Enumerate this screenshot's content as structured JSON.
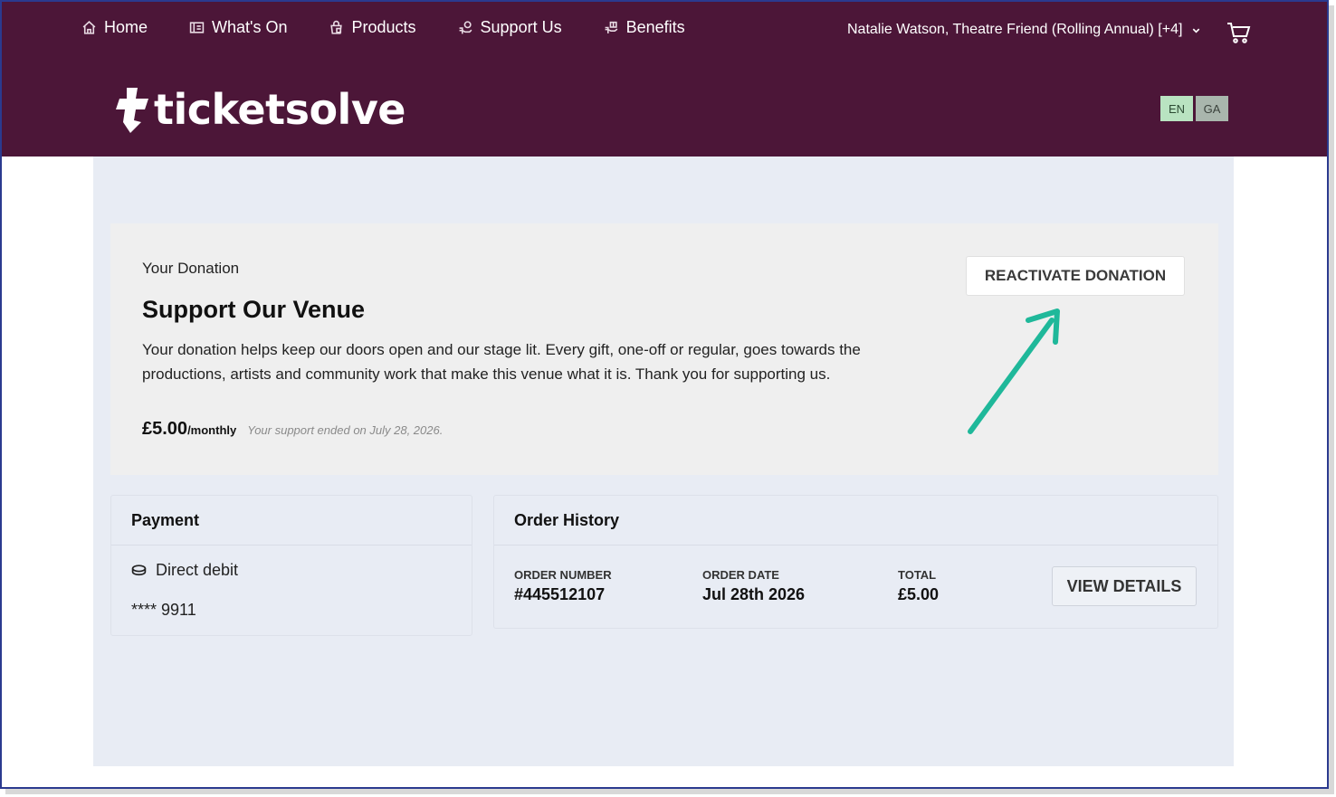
{
  "nav": {
    "items": [
      {
        "label": "Home",
        "icon": "home-icon"
      },
      {
        "label": "What's On",
        "icon": "ticket-icon"
      },
      {
        "label": "Products",
        "icon": "shopping-bag-icon"
      },
      {
        "label": "Support Us",
        "icon": "donate-icon"
      },
      {
        "label": "Benefits",
        "icon": "gift-hand-icon"
      }
    ],
    "user_label": "Natalie Watson, Theatre Friend (Rolling Annual) [+4]",
    "cart_icon": "cart-icon"
  },
  "brand": {
    "name": "ticketsolve",
    "header_color": "#4c1638"
  },
  "language": {
    "options": [
      "EN",
      "GA"
    ],
    "selected": "EN"
  },
  "donation": {
    "label": "Your Donation",
    "title": "Support Our Venue",
    "description": "Your donation helps keep our doors open and our stage lit. Every gift, one-off or regular, goes towards the productions, artists and community work that make this venue what it is. Thank you for supporting us.",
    "amount": "£5.00",
    "period": "/monthly",
    "ended_note": "Your support ended on July 28, 2026.",
    "reactivate_label": "REACTIVATE DONATION",
    "arrow_color": "#1fb89a"
  },
  "payment": {
    "title": "Payment",
    "method": "Direct debit",
    "method_icon": "coins-icon",
    "masked_number": "**** 9911"
  },
  "order_history": {
    "title": "Order History",
    "columns": [
      {
        "label": "ORDER NUMBER",
        "value": "#445512107"
      },
      {
        "label": "ORDER DATE",
        "value": "Jul 28th 2026"
      },
      {
        "label": "TOTAL",
        "value": "£5.00"
      }
    ],
    "view_label": "VIEW DETAILS"
  }
}
